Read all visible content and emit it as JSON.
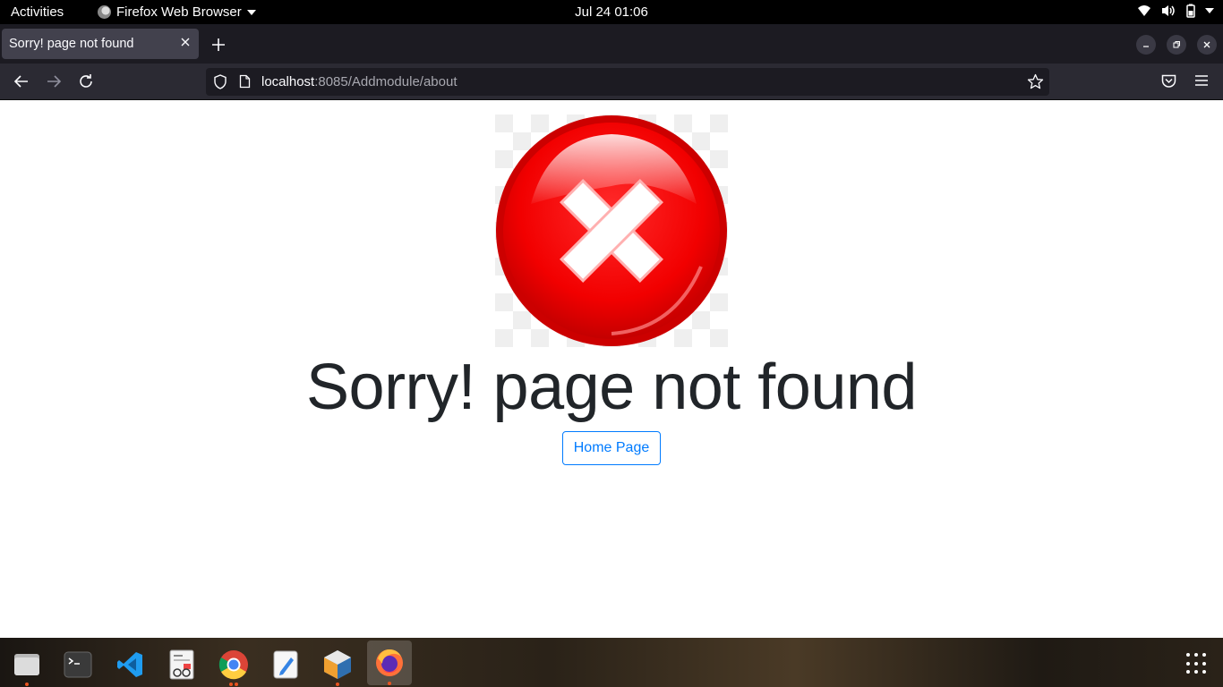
{
  "system": {
    "activities": "Activities",
    "app_name": "Firefox Web Browser",
    "clock": "Jul 24  01:06"
  },
  "browser": {
    "tab_title": "Sorry! page not found",
    "url_host": "localhost",
    "url_rest": ":8085/Addmodule/about"
  },
  "page": {
    "headline": "Sorry! page not found",
    "home_button": "Home Page",
    "colors": {
      "error_red": "#ff0000",
      "primary": "#007bff",
      "text": "#212529"
    }
  },
  "dock": {
    "apps": [
      "files",
      "terminal",
      "vscode",
      "document-viewer",
      "chrome",
      "text-editor",
      "netbeans",
      "firefox"
    ]
  }
}
